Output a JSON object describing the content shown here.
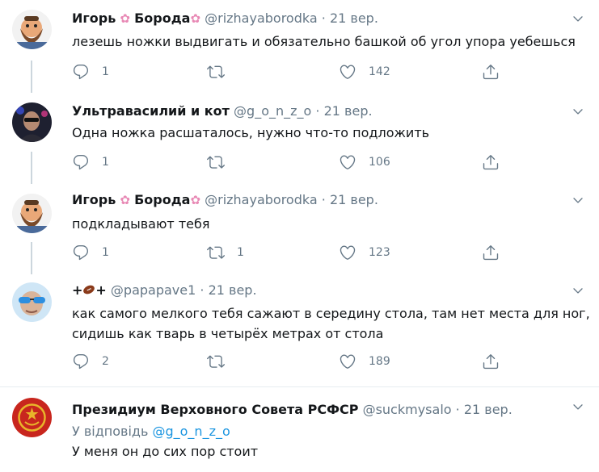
{
  "tweets": [
    {
      "name": "Игорь",
      "name_suffix": "Борода",
      "handle": "@rizhayaborodka",
      "date": "21 вер.",
      "text": "лезешь ножки выдвигать и обязательно башкой об угол упора уебешься",
      "reply": "1",
      "retweet": "",
      "like": "142"
    },
    {
      "name": "Ультравасилий и кот",
      "handle": "@g_o_n_z_o",
      "date": "21 вер.",
      "text": "Одна ножка расшаталось, нужно что-то подложить",
      "reply": "1",
      "retweet": "",
      "like": "106"
    },
    {
      "name": "Игорь",
      "name_suffix": "Борода",
      "handle": "@rizhayaborodka",
      "date": "21 вер.",
      "text": "подкладывают тебя",
      "reply": "1",
      "retweet": "1",
      "like": "123"
    },
    {
      "name": "+",
      "name_suffix": "+",
      "handle": "@papapave1",
      "date": "21 вер.",
      "text_line1": "как самого мелкого тебя сажают в середину стола, там нет места для ног,",
      "text_line2": "сидишь как тварь в четырёх метрах от стола",
      "reply": "2",
      "retweet": "",
      "like": "189"
    },
    {
      "name": "Президиум Верховного Совета РСФСР",
      "handle": "@suckmysalo",
      "date": "21 вер.",
      "reply_prefix": "У відповідь",
      "reply_to": "@g_o_n_z_o",
      "text": "У меня он до сих пор стоит"
    }
  ],
  "dot": "·",
  "flower_glyph": "✿",
  "colors": {
    "accent": "#1b95e0",
    "muted": "#657786",
    "text": "#14171a",
    "divider": "#e6ecf0"
  },
  "icons": [
    "reply-icon",
    "retweet-icon",
    "like-icon",
    "share-icon",
    "chevron-down-icon"
  ]
}
